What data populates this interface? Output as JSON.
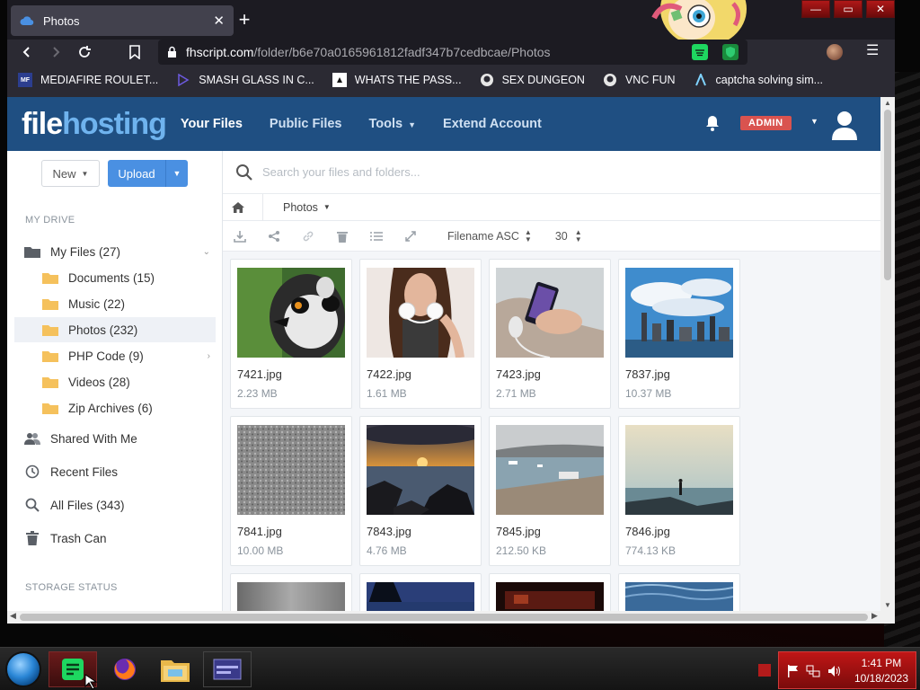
{
  "browser": {
    "tab_title": "Photos",
    "tab_close": "✕",
    "new_tab": "+",
    "url_host": "fhscript.com",
    "url_path": "/folder/b6e70a0165961812fadf347b7cedbcae/Photos",
    "menu": "☰",
    "window_controls": [
      "—",
      "▭",
      "✕"
    ]
  },
  "bookmarks": [
    {
      "label": "MEDIAFIRE ROULET...",
      "icon": "mediafire-icon"
    },
    {
      "label": "SMASH GLASS IN C...",
      "icon": "glass-icon"
    },
    {
      "label": "WHATS THE PASS...",
      "icon": "lock-icon"
    },
    {
      "label": "SEX DUNGEON",
      "icon": "github-icon"
    },
    {
      "label": "VNC FUN",
      "icon": "github-icon"
    },
    {
      "label": "captcha solving sim...",
      "icon": "arrow-icon"
    }
  ],
  "header": {
    "logo_a": "file",
    "logo_b": "hosting",
    "nav": [
      {
        "label": "Your Files",
        "active": true
      },
      {
        "label": "Public Files",
        "active": false
      },
      {
        "label": "Tools",
        "active": false,
        "dropdown": true
      },
      {
        "label": "Extend Account",
        "active": false
      }
    ],
    "admin_badge": "ADMIN"
  },
  "sidebar": {
    "new_label": "New",
    "upload_label": "Upload",
    "my_drive_heading": "MY DRIVE",
    "storage_heading": "STORAGE STATUS",
    "items": [
      {
        "label": "My Files (27)",
        "icon": "folder-dark-icon"
      },
      {
        "label": "Documents (15)",
        "icon": "folder-icon"
      },
      {
        "label": "Music (22)",
        "icon": "folder-icon"
      },
      {
        "label": "Photos (232)",
        "icon": "folder-icon",
        "active": true
      },
      {
        "label": "PHP Code (9)",
        "icon": "folder-icon"
      },
      {
        "label": "Videos (28)",
        "icon": "folder-icon"
      },
      {
        "label": "Zip Archives (6)",
        "icon": "folder-icon"
      },
      {
        "label": "Shared With Me",
        "icon": "users-icon"
      },
      {
        "label": "Recent Files",
        "icon": "clock-icon"
      },
      {
        "label": "All Files (343)",
        "icon": "search-icon"
      },
      {
        "label": "Trash Can",
        "icon": "trash-icon"
      }
    ]
  },
  "main": {
    "search_placeholder": "Search your files and folders...",
    "breadcrumb": "Photos",
    "sort_label": "Filename ASC",
    "per_page": "30"
  },
  "files": [
    {
      "name": "7421.jpg",
      "size": "2.23 MB"
    },
    {
      "name": "7422.jpg",
      "size": "1.61 MB"
    },
    {
      "name": "7423.jpg",
      "size": "2.71 MB"
    },
    {
      "name": "7837.jpg",
      "size": "10.37 MB"
    },
    {
      "name": "7841.jpg",
      "size": "10.00 MB"
    },
    {
      "name": "7843.jpg",
      "size": "4.76 MB"
    },
    {
      "name": "7845.jpg",
      "size": "212.50 KB"
    },
    {
      "name": "7846.jpg",
      "size": "774.13 KB"
    },
    {
      "name": "",
      "size": ""
    },
    {
      "name": "",
      "size": ""
    },
    {
      "name": "",
      "size": ""
    },
    {
      "name": "",
      "size": ""
    }
  ],
  "taskbar": {
    "time": "1:41 PM",
    "date": "10/18/2023"
  },
  "colors": {
    "header_bg": "#1f4f82",
    "logo_accent": "#6fb3ee",
    "upload_button": "#4a90e2",
    "admin_badge": "#d9534f"
  }
}
